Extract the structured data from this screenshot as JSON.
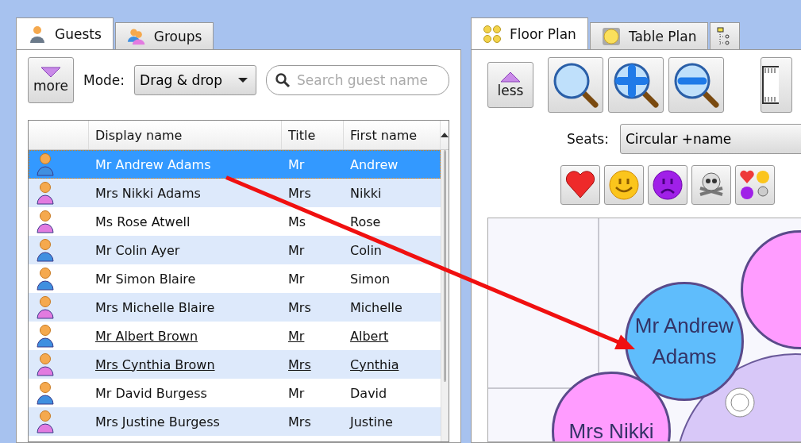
{
  "guests_panel": {
    "tabs": [
      {
        "label": "Guests",
        "kind": "guest",
        "selected": true
      },
      {
        "label": "Groups",
        "kind": "group",
        "selected": false
      }
    ],
    "more_button": "more",
    "mode_label": "Mode:",
    "mode_value": "Drag & drop",
    "search": {
      "placeholder": "Search guest name"
    },
    "table": {
      "columns": [
        "Display name",
        "Title",
        "First name"
      ],
      "rows": [
        {
          "display_name": "Mr Andrew Adams",
          "title": "Mr",
          "first_name": "Andrew",
          "kind": "male",
          "selected": true,
          "underlined": false
        },
        {
          "display_name": "Mrs Nikki Adams",
          "title": "Mrs",
          "first_name": "Nikki",
          "kind": "female",
          "selected": false,
          "underlined": false
        },
        {
          "display_name": "Ms Rose Atwell",
          "title": "Ms",
          "first_name": "Rose",
          "kind": "female",
          "selected": false,
          "underlined": false
        },
        {
          "display_name": "Mr Colin Ayer",
          "title": "Mr",
          "first_name": "Colin",
          "kind": "male",
          "selected": false,
          "underlined": false
        },
        {
          "display_name": "Mr Simon Blaire",
          "title": "Mr",
          "first_name": "Simon",
          "kind": "male",
          "selected": false,
          "underlined": false
        },
        {
          "display_name": "Mrs Michelle Blaire",
          "title": "Mrs",
          "first_name": "Michelle",
          "kind": "female",
          "selected": false,
          "underlined": false
        },
        {
          "display_name": "Mr Albert Brown",
          "title": "Mr",
          "first_name": "Albert",
          "kind": "male",
          "selected": false,
          "underlined": true
        },
        {
          "display_name": "Mrs Cynthia Brown",
          "title": "Mrs",
          "first_name": "Cynthia",
          "kind": "female",
          "selected": false,
          "underlined": true
        },
        {
          "display_name": "Mr David Burgess",
          "title": "Mr",
          "first_name": "David",
          "kind": "male",
          "selected": false,
          "underlined": false
        },
        {
          "display_name": "Mrs Justine Burgess",
          "title": "Mrs",
          "first_name": "Justine",
          "kind": "female",
          "selected": false,
          "underlined": false
        }
      ]
    }
  },
  "plan_panel": {
    "tabs": [
      {
        "label": "Floor Plan",
        "kind": "floor",
        "selected": true
      },
      {
        "label": "Table Plan",
        "kind": "table",
        "selected": false
      },
      {
        "kind": "tree",
        "selected": false
      }
    ],
    "less_button": "less",
    "seats_label": "Seats:",
    "seats_value": "Circular +name",
    "seats": [
      {
        "name": "Mr Andrew Adams",
        "kind": "male"
      },
      {
        "name": "Mrs Nikki",
        "kind": "female"
      },
      {
        "kind": "female"
      }
    ]
  }
}
